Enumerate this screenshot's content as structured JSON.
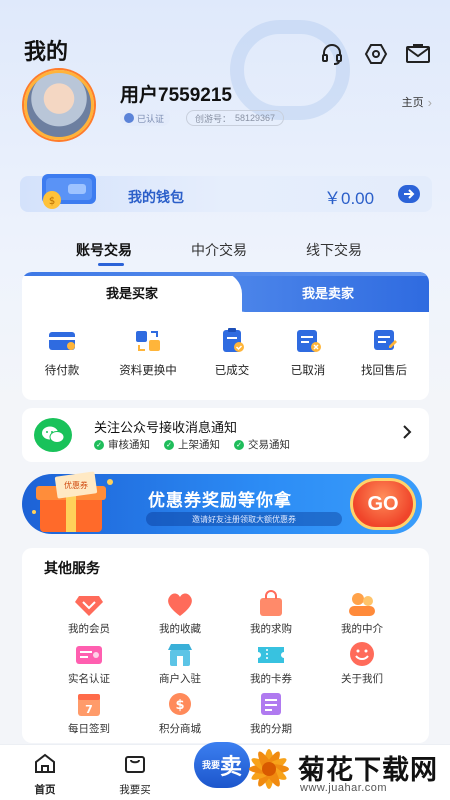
{
  "header": {
    "title": "我的",
    "icons": [
      "headset-icon",
      "settings-hex-icon",
      "mail-icon"
    ]
  },
  "profile": {
    "username": "用户7559215",
    "verified_label": "已认证",
    "game_id_label": "创游号：",
    "game_id_value": "58129367",
    "homepage_label": "主页"
  },
  "wallet": {
    "label": "我的钱包",
    "amount": "￥0.00"
  },
  "trade_tabs": [
    {
      "label": "账号交易",
      "active": true
    },
    {
      "label": "中介交易",
      "active": false
    },
    {
      "label": "线下交易",
      "active": false
    }
  ],
  "order_card": {
    "buyer_tab": "我是买家",
    "seller_tab": "我是卖家",
    "items": [
      {
        "label": "待付款",
        "icon": "card-icon"
      },
      {
        "label": "资料更换中",
        "icon": "swap-icon"
      },
      {
        "label": "已成交",
        "icon": "clipboard-done-icon"
      },
      {
        "label": "已取消",
        "icon": "cancel-icon"
      },
      {
        "label": "找回售后",
        "icon": "after-sale-icon"
      }
    ]
  },
  "notify": {
    "title": "关注公众号接收消息通知",
    "tags": [
      "审核通知",
      "上架通知",
      "交易通知"
    ]
  },
  "banner": {
    "title": "优惠券奖励等你拿",
    "subtitle": "邀请好友注册领取大额优惠券",
    "go_label": "GO",
    "box_label": "优惠券"
  },
  "services": {
    "title": "其他服务",
    "items": [
      {
        "label": "我的会员",
        "icon": "member-icon"
      },
      {
        "label": "我的收藏",
        "icon": "heart-icon"
      },
      {
        "label": "我的求购",
        "icon": "bag-icon"
      },
      {
        "label": "我的中介",
        "icon": "agent-icon"
      },
      {
        "label": "实名认证",
        "icon": "id-card-icon"
      },
      {
        "label": "商户入驻",
        "icon": "shop-icon"
      },
      {
        "label": "我的卡券",
        "icon": "ticket-icon"
      },
      {
        "label": "关于我们",
        "icon": "smile-icon"
      },
      {
        "label": "每日签到",
        "icon": "calendar-icon"
      },
      {
        "label": "积分商城",
        "icon": "points-icon"
      },
      {
        "label": "我的分期",
        "icon": "installment-icon"
      }
    ]
  },
  "bottom_nav": {
    "home": "首页",
    "buy": "我要买",
    "sell_small": "我要",
    "sell_big": "卖"
  },
  "watermark": {
    "text": "菊花下载网",
    "url": "www.juahar.com"
  },
  "colors": {
    "accent": "#2c63d8",
    "wechat": "#19c25a",
    "banner": "#1d62d6",
    "go": "#f0452a"
  }
}
